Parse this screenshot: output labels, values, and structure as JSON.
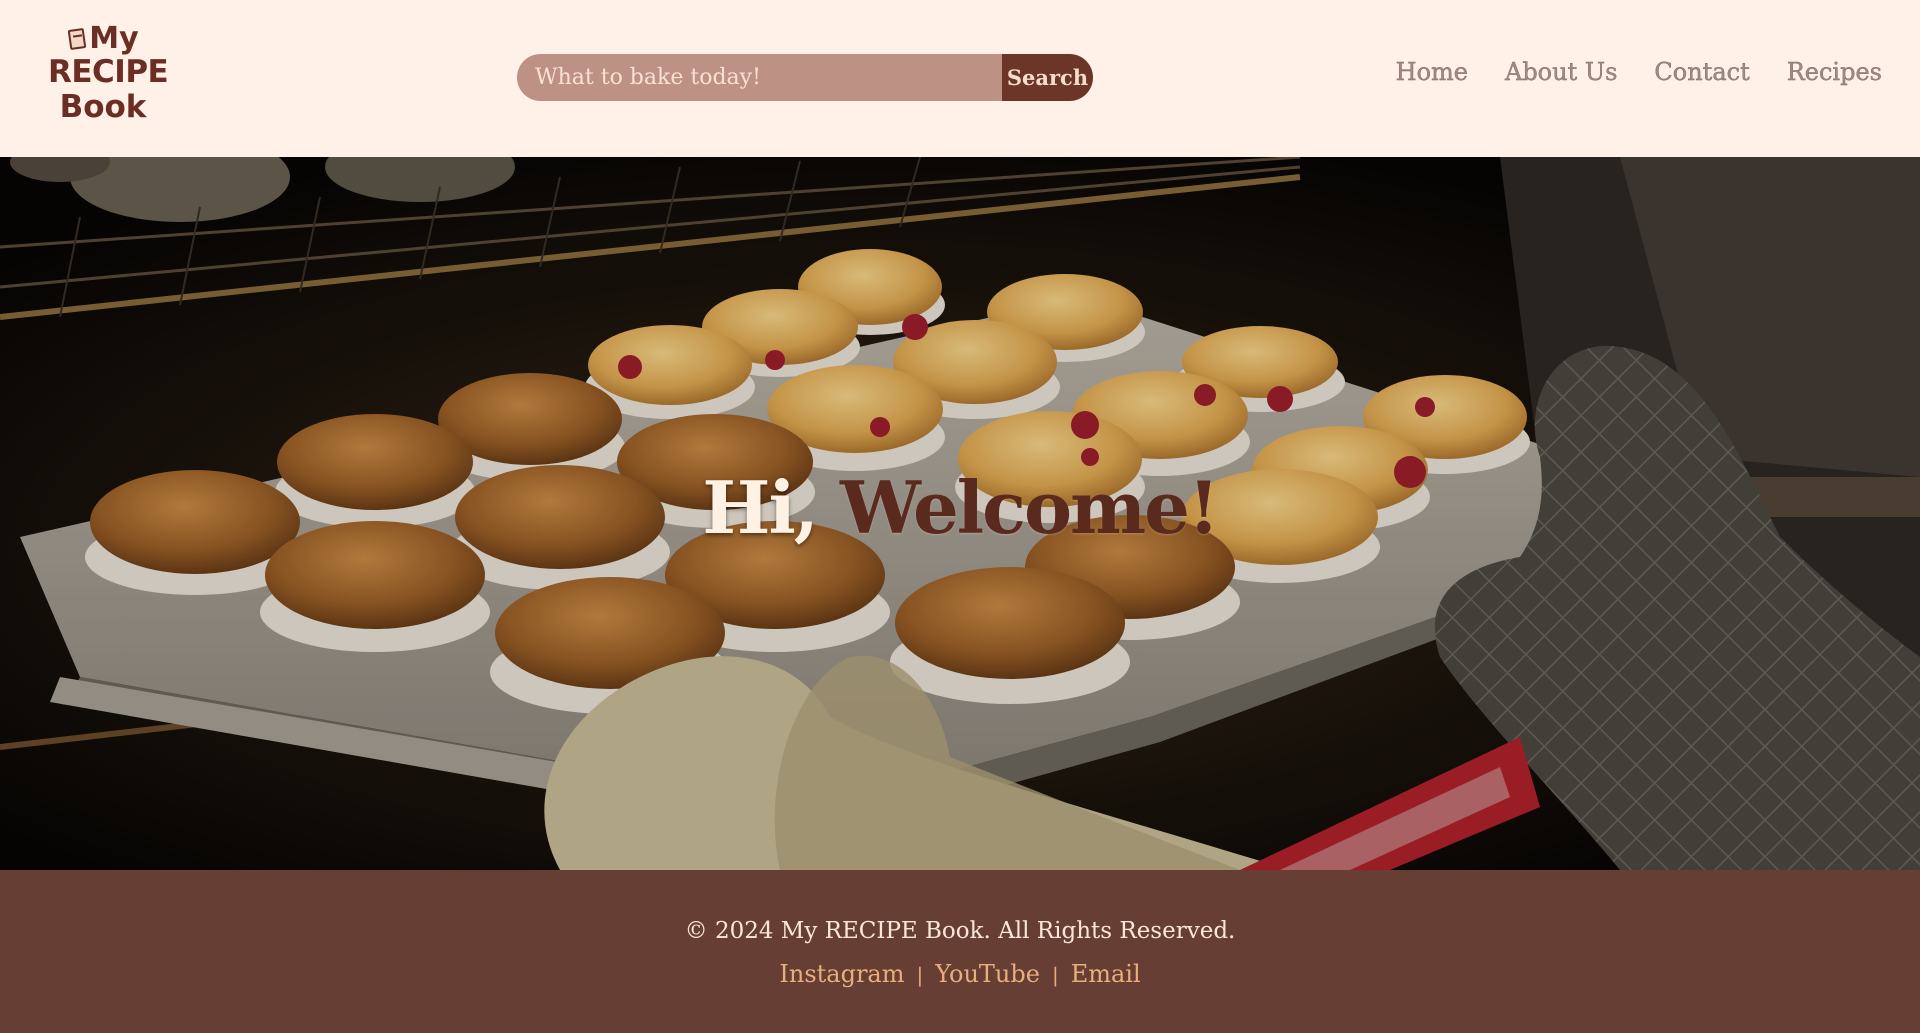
{
  "header": {
    "logo": {
      "line1": "My",
      "line2": "RECIPE",
      "line3": "Book"
    },
    "search": {
      "placeholder": "What to bake today!",
      "value": "",
      "button_label": "Search"
    },
    "nav": [
      {
        "label": "Home"
      },
      {
        "label": "About Us"
      },
      {
        "label": "Contact"
      },
      {
        "label": "Recipes"
      }
    ]
  },
  "hero": {
    "greeting": "Hi,",
    "welcome": "Welcome!",
    "image_subject": "muffin tray in oven held by oven mitts"
  },
  "footer": {
    "copyright": "© 2024 My RECIPE Book. All Rights Reserved.",
    "links": [
      {
        "label": "Instagram"
      },
      {
        "label": "YouTube"
      },
      {
        "label": "Email"
      }
    ],
    "separator": "|"
  },
  "colors": {
    "header_bg": "#fff1e7",
    "brand_brown": "#6b2e24",
    "search_field": "#bd9285",
    "search_button": "#6b3528",
    "nav_text": "#a08a85",
    "footer_bg": "#673e33",
    "footer_link": "#e8ae7e"
  }
}
